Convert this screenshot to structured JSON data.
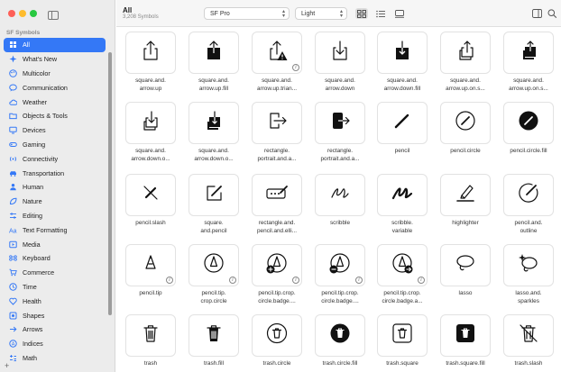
{
  "window": {
    "sidebar_section": "SF Symbols",
    "header_title": "All",
    "header_subtitle": "3,208 Symbols",
    "font_popup": "SF Pro",
    "weight_popup": "Light",
    "add_button": "+"
  },
  "sidebar": {
    "items": [
      {
        "label": "All",
        "icon": "grid-icon",
        "active": true
      },
      {
        "label": "What's New",
        "icon": "sparkle-icon"
      },
      {
        "label": "Multicolor",
        "icon": "palette-icon"
      },
      {
        "label": "Communication",
        "icon": "bubble-icon"
      },
      {
        "label": "Weather",
        "icon": "cloud-icon"
      },
      {
        "label": "Objects & Tools",
        "icon": "folder-icon"
      },
      {
        "label": "Devices",
        "icon": "display-icon"
      },
      {
        "label": "Gaming",
        "icon": "gamecontroller-icon"
      },
      {
        "label": "Connectivity",
        "icon": "antenna-icon"
      },
      {
        "label": "Transportation",
        "icon": "car-icon"
      },
      {
        "label": "Human",
        "icon": "person-icon"
      },
      {
        "label": "Nature",
        "icon": "leaf-icon"
      },
      {
        "label": "Editing",
        "icon": "sliders-icon"
      },
      {
        "label": "Text Formatting",
        "icon": "textformat-icon"
      },
      {
        "label": "Media",
        "icon": "play-icon"
      },
      {
        "label": "Keyboard",
        "icon": "command-icon"
      },
      {
        "label": "Commerce",
        "icon": "cart-icon"
      },
      {
        "label": "Time",
        "icon": "clock-icon"
      },
      {
        "label": "Health",
        "icon": "heart-icon"
      },
      {
        "label": "Shapes",
        "icon": "square-icon"
      },
      {
        "label": "Arrows",
        "icon": "arrow-right-icon"
      },
      {
        "label": "Indices",
        "icon": "indices-icon"
      },
      {
        "label": "Math",
        "icon": "math-icon"
      }
    ]
  },
  "symbols": [
    {
      "label": "square.and.\narrow.up",
      "icon": "share-icon"
    },
    {
      "label": "square.and.\narrow.up.fill",
      "icon": "share-fill-icon"
    },
    {
      "label": "square.and.\narrow.up.trian...",
      "icon": "share-triangle-icon",
      "info": true
    },
    {
      "label": "square.and.\narrow.down",
      "icon": "download-icon"
    },
    {
      "label": "square.and.\narrow.down.fill",
      "icon": "download-fill-icon"
    },
    {
      "label": "square.and.\narrow.up.on.s...",
      "icon": "share-stack-icon"
    },
    {
      "label": "square.and.\narrow.up.on.s...",
      "icon": "share-stack-fill-icon"
    },
    {
      "label": "square.and.\narrow.down.o...",
      "icon": "download-stack-icon"
    },
    {
      "label": "square.and.\narrow.down.o...",
      "icon": "download-stack-fill-icon"
    },
    {
      "label": "rectangle.\nportrait.and.a...",
      "icon": "portrait-arrow-icon"
    },
    {
      "label": "rectangle.\nportrait.and.a...",
      "icon": "portrait-arrow-fill-icon"
    },
    {
      "label": "pencil",
      "icon": "pencil-icon"
    },
    {
      "label": "pencil.circle",
      "icon": "pencil-circle-icon"
    },
    {
      "label": "pencil.circle.fill",
      "icon": "pencil-circle-fill-icon"
    },
    {
      "label": "pencil.slash",
      "icon": "pencil-slash-icon"
    },
    {
      "label": "square.\nand.pencil",
      "icon": "square-pencil-icon"
    },
    {
      "label": "rectangle.and.\npencil.and.elli...",
      "icon": "rect-pencil-ellipsis-icon"
    },
    {
      "label": "scribble",
      "icon": "scribble-icon"
    },
    {
      "label": "scribble.\nvariable",
      "icon": "scribble-variable-icon"
    },
    {
      "label": "highlighter",
      "icon": "highlighter-icon"
    },
    {
      "label": "pencil.and.\noutline",
      "icon": "pencil-outline-icon"
    },
    {
      "label": "pencil.tip",
      "icon": "pencil-tip-icon",
      "info": true
    },
    {
      "label": "pencil.tip.\ncrop.circle",
      "icon": "pencil-tip-circle-icon",
      "info": true
    },
    {
      "label": "pencil.tip.crop.\ncircle.badge....",
      "icon": "pencil-tip-plus-icon",
      "info": true
    },
    {
      "label": "pencil.tip.crop.\ncircle.badge....",
      "icon": "pencil-tip-minus-icon",
      "info": true
    },
    {
      "label": "pencil.tip.crop.\ncircle.badge.a...",
      "icon": "pencil-tip-arrow-icon",
      "info": true
    },
    {
      "label": "lasso",
      "icon": "lasso-icon"
    },
    {
      "label": "lasso.and.\nsparkles",
      "icon": "lasso-sparkles-icon"
    },
    {
      "label": "trash",
      "icon": "trash-icon"
    },
    {
      "label": "trash.fill",
      "icon": "trash-fill-icon"
    },
    {
      "label": "trash.circle",
      "icon": "trash-circle-icon"
    },
    {
      "label": "trash.circle.fill",
      "icon": "trash-circle-fill-icon"
    },
    {
      "label": "trash.square",
      "icon": "trash-square-icon"
    },
    {
      "label": "trash.square.fill",
      "icon": "trash-square-fill-icon"
    },
    {
      "label": "trash.slash",
      "icon": "trash-slash-icon"
    }
  ],
  "colors": {
    "accent": "#3478f6"
  }
}
